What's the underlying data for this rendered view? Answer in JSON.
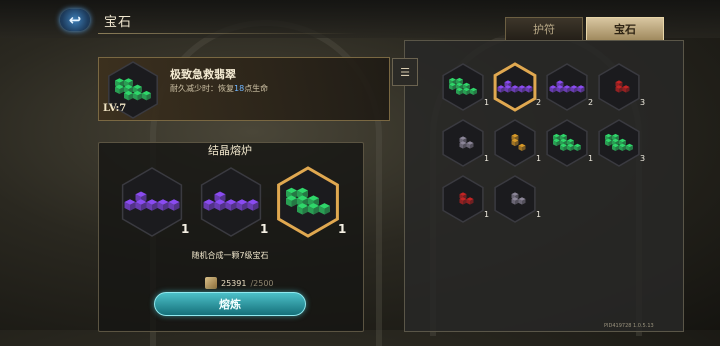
{
  "header": {
    "title": "宝石",
    "back_icon": "back-arrow-icon"
  },
  "tabs": [
    {
      "label": "护符",
      "active": false
    },
    {
      "label": "宝石",
      "active": true
    }
  ],
  "selected_gem": {
    "name": "极致急救翡翠",
    "desc_prefix": "耐久减少时：恢复",
    "desc_value": "18",
    "desc_suffix": "点生命",
    "level": "LV:7",
    "color": "green"
  },
  "furnace": {
    "title": "结晶熔炉",
    "slots": [
      {
        "color": "purple",
        "count": "1"
      },
      {
        "color": "purple",
        "count": "1"
      },
      {
        "color": "green",
        "count": "1",
        "selected": true
      }
    ],
    "hint": "随机合成一颗7级宝石",
    "cost_current": "25391",
    "cost_max": "/2500",
    "button_label": "熔炼"
  },
  "inventory": [
    {
      "color": "green",
      "count": "1",
      "selected": false
    },
    {
      "color": "purple",
      "count": "2",
      "selected": true
    },
    {
      "color": "purple",
      "count": "2",
      "selected": false
    },
    {
      "color": "red",
      "count": "3",
      "selected": false
    },
    {
      "color": "gray",
      "count": "1",
      "selected": false
    },
    {
      "color": "orange",
      "count": "1",
      "selected": false
    },
    {
      "color": "green",
      "count": "1",
      "selected": false
    },
    {
      "color": "green",
      "count": "3",
      "selected": false
    },
    {
      "color": "red",
      "count": "1",
      "selected": false
    },
    {
      "color": "gray",
      "count": "1",
      "selected": false
    }
  ],
  "version": "PID419728 1.0.5.13",
  "colors": {
    "green": "#2fd66a",
    "purple": "#8a4bf0",
    "red": "#c42424",
    "gray": "#8c8698",
    "orange": "#d89a28",
    "selected_border": "#e0a850"
  }
}
